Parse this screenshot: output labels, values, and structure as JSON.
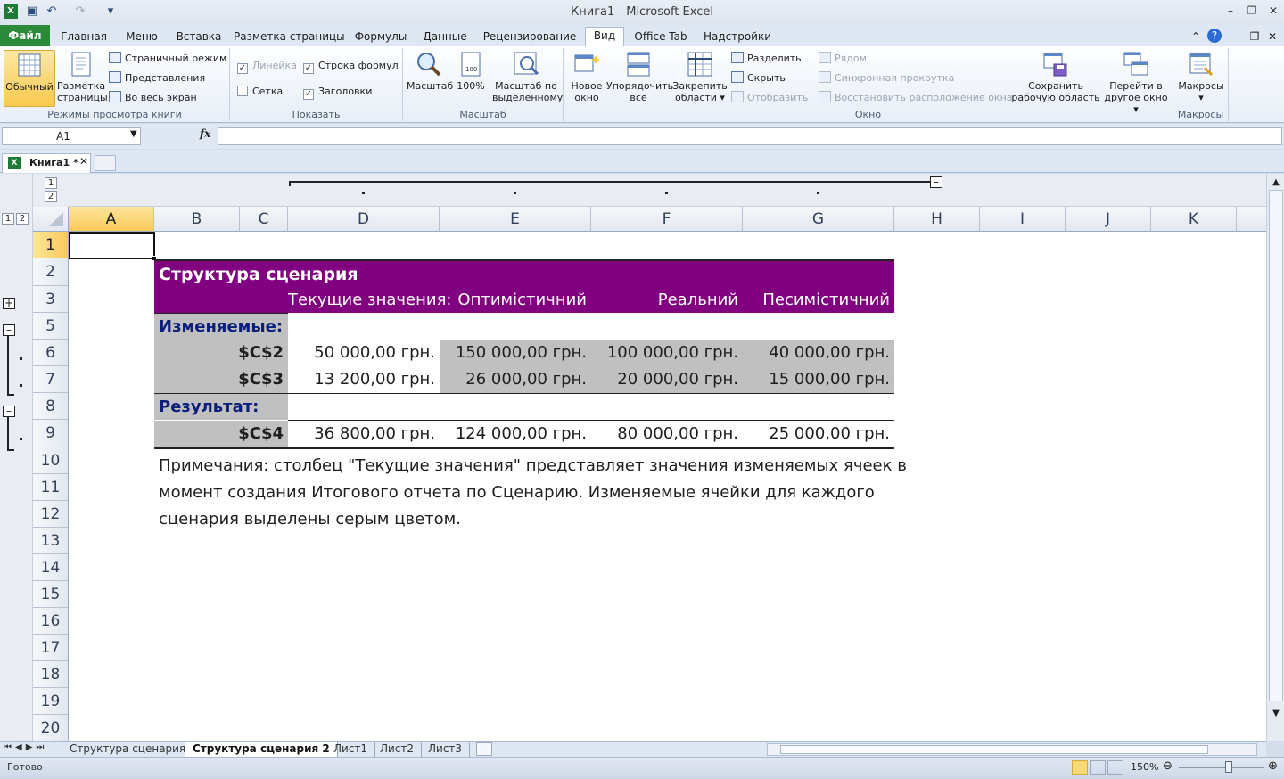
{
  "window": {
    "title": "Книга1  -  Microsoft Excel"
  },
  "tabs": [
    {
      "label": "Файл"
    },
    {
      "label": "Главная"
    },
    {
      "label": "Меню"
    },
    {
      "label": "Вставка"
    },
    {
      "label": "Разметка страницы"
    },
    {
      "label": "Формулы"
    },
    {
      "label": "Данные"
    },
    {
      "label": "Рецензирование"
    },
    {
      "label": "Вид"
    },
    {
      "label": "Office Tab"
    },
    {
      "label": "Надстройки"
    }
  ],
  "ribbon": {
    "g1": {
      "label": "Режимы просмотра книги",
      "normal": "Обычный",
      "layout1": "Разметка",
      "layout2": "страницы",
      "pagebreak": "Страничный режим",
      "views": "Представления",
      "fullscreen": "Во весь экран"
    },
    "g2": {
      "label": "Показать",
      "ruler": "Линейка",
      "formulabar": "Строка формул",
      "grid": "Сетка",
      "headings": "Заголовки"
    },
    "g3": {
      "label": "Масштаб",
      "zoom": "Масштаб",
      "z100": "100%",
      "zsel1": "Масштаб по",
      "zsel2": "выделенному"
    },
    "g4": {
      "label": "Окно",
      "newwin1": "Новое",
      "newwin2": "окно",
      "arrange1": "Упорядочить",
      "arrange2": "все",
      "freeze1": "Закрепить",
      "freeze2": "области",
      "split": "Разделить",
      "hide": "Скрыть",
      "unhide": "Отобразить",
      "side": "Рядом",
      "sync": "Синхронная прокрутка",
      "reset": "Восстановить расположение окна",
      "save1": "Сохранить",
      "save2": "рабочую область",
      "switch1": "Перейти в",
      "switch2": "другое окно"
    },
    "g5": {
      "label": "Макросы",
      "macros": "Макросы"
    }
  },
  "formula": {
    "namebox": "A1",
    "fx": "fx"
  },
  "doctab": {
    "label": "Книга1 *"
  },
  "outline": {
    "levels": [
      "1",
      "2"
    ]
  },
  "columns": [
    "A",
    "B",
    "C",
    "D",
    "E",
    "F",
    "G",
    "H",
    "I",
    "J",
    "K"
  ],
  "rows": [
    "1",
    "2",
    "3",
    "5",
    "6",
    "7",
    "8",
    "9",
    "10",
    "11",
    "12",
    "13",
    "14",
    "15",
    "16",
    "17",
    "18",
    "19",
    "20"
  ],
  "sheet": {
    "title": "Структура сценария",
    "h_current": "Текущие значения:",
    "h_opt": "Оптимістичний",
    "h_real": "Реальний",
    "h_pes": "Песимістичний",
    "changing": "Изменяемые:",
    "r6": {
      "label": "$C$2",
      "cur": "50 000,00 грн.",
      "opt": "150 000,00 грн.",
      "real": "100 000,00 грн.",
      "pes": "40 000,00 грн."
    },
    "r7": {
      "label": "$C$3",
      "cur": "13 200,00 грн.",
      "opt": "26 000,00 грн.",
      "real": "20 000,00 грн.",
      "pes": "15 000,00 грн."
    },
    "result": "Результат:",
    "r9": {
      "label": "$C$4",
      "cur": "36 800,00 грн.",
      "opt": "124 000,00 грн.",
      "real": "80 000,00 грн.",
      "pes": "25 000,00 грн."
    },
    "note1": "Примечания: столбец \"Текущие значения\" представляет значения изменяемых ячеек в",
    "note2": "момент создания Итогового отчета по Сценарию. Изменяемые ячейки для каждого",
    "note3": "сценария выделены серым цветом."
  },
  "sheettabs": [
    "Структура сценария",
    "Структура сценария 2",
    "Лист1",
    "Лист2",
    "Лист3"
  ],
  "status": {
    "ready": "Готово",
    "zoom": "150%"
  }
}
